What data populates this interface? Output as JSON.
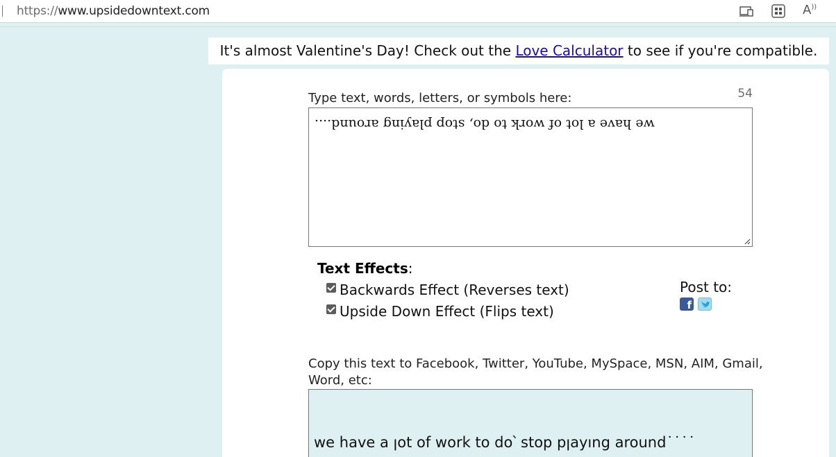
{
  "browser": {
    "url_scheme": "https://",
    "url_host": "www.upsidedowntext.com",
    "toolbar_icons": [
      "device-icon",
      "apps-icon",
      "read-aloud-icon"
    ],
    "read_aloud_label": "A"
  },
  "banner": {
    "prefix": "It's almost Valentine's Day! Check out the ",
    "link_text": "Love Calculator",
    "suffix": " to see if you're compatible.",
    "link_color": "#1a0dab"
  },
  "input": {
    "label": "Type text, words, letters, or symbols here:",
    "char_count": "54",
    "value": "we have a lot of work to do, stop playing around...."
  },
  "effects": {
    "title": "Text Effects",
    "title_suffix": ":",
    "options": [
      {
        "label": "Backwards Effect (Reverses text)",
        "checked": true
      },
      {
        "label": "Upside Down Effect (Flips text)",
        "checked": true
      }
    ]
  },
  "post": {
    "label": "Post to:",
    "facebook_glyph": "f",
    "services": [
      "facebook-icon",
      "twitter-icon"
    ]
  },
  "output": {
    "label": "Copy this text to Facebook, Twitter, YouTube, MySpace, MSN, AIM, Gmail, Word, etc:",
    "value": "we have a ןot of work to do՝ stop pןayıng around˙˙˙˙"
  },
  "colors": {
    "page_background": "#dff0f2",
    "output_background": "#dff0f2",
    "facebook": "#3b5998",
    "twitter": "#9fdcf2"
  }
}
